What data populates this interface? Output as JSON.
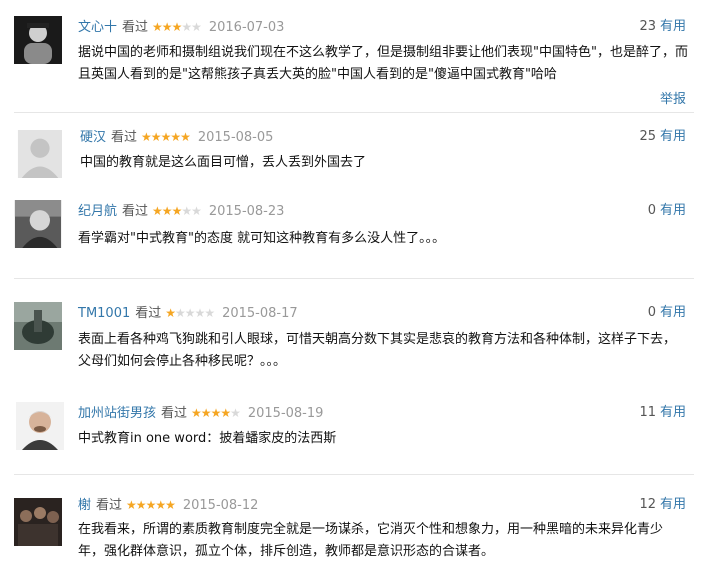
{
  "reviews": [
    {
      "user": "文心十",
      "rated": "看过",
      "stars": 3,
      "date": "2016-07-03",
      "useful_count": "23",
      "useful_label": "有用",
      "text": "据说中国的老师和摄制组说我们现在不这么教学了，但是摄制组非要让他们表现\"中国特色\"，也是醉了，而且英国人看到的是\"这帮熊孩子真丢大英的脸\"中国人看到的是\"傻逼中国式教育\"哈哈",
      "report": "举报"
    },
    {
      "user": "硬汉",
      "rated": "看过",
      "stars": 5,
      "date": "2015-08-05",
      "useful_count": "25",
      "useful_label": "有用",
      "text": "中国的教育就是这么面目可憎，丢人丢到外国去了"
    },
    {
      "user": "纪月航",
      "rated": "看过",
      "stars": 3,
      "date": "2015-08-23",
      "useful_count": "0",
      "useful_label": "有用",
      "text": "看学霸对\"中式教育\"的态度 就可知这种教育有多么没人性了。。。"
    },
    {
      "user": "TM1001",
      "rated": "看过",
      "stars": 1,
      "date": "2015-08-17",
      "useful_count": "0",
      "useful_label": "有用",
      "text": "表面上看各种鸡飞狗跳和引人眼球，可惜天朝高分数下其实是悲哀的教育方法和各种体制，这样子下去，父母们如何会停止各种移民呢？。。。"
    },
    {
      "user": "加州站街男孩",
      "rated": "看过",
      "stars": 4,
      "date": "2015-08-19",
      "useful_count": "11",
      "useful_label": "有用",
      "text": "中式教育in one word：披着蟠家皮的法西斯"
    },
    {
      "user": "榭",
      "rated": "看过",
      "stars": 5,
      "date": "2015-08-12",
      "useful_count": "12",
      "useful_label": "有用",
      "text": "在我看来，所谓的素质教育制度完全就是一场谋杀，它消灭个性和想象力，用一种黑暗的未来异化青少年，强化群体意识，孤立个体，排斥创造，教师都是意识形态的合谋者。"
    }
  ],
  "star_glyph": "★",
  "colors": {
    "link": "#3377aa",
    "star_on": "#f5a623",
    "star_off": "#d9d9d9"
  }
}
